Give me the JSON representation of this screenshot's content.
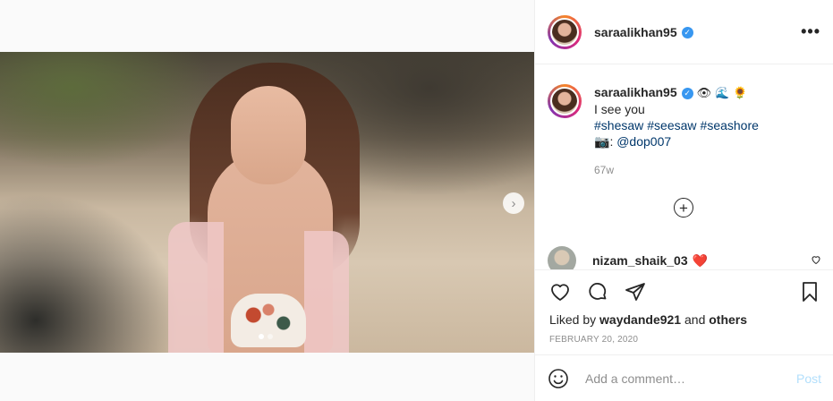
{
  "post": {
    "username": "saraalikhan95",
    "more_label": "•••"
  },
  "caption": {
    "username": "saraalikhan95",
    "emojis": [
      "👁",
      "🌊",
      "🌻"
    ],
    "text": "I see you",
    "hashtags": [
      "#shesaw",
      "#seesaw",
      "#seashore"
    ],
    "credit_emoji": "📷",
    "credit_sep": ":",
    "credit_mention": "@dop007",
    "time_ago": "67w"
  },
  "load_more_label": "+",
  "comments": [
    {
      "username": "nizam_shaik_03",
      "text": "❤️"
    }
  ],
  "likes": {
    "prefix": "Liked by",
    "user": "waydande921",
    "conj": "and",
    "others": "others"
  },
  "date": "FEBRUARY 20, 2020",
  "comment_box": {
    "placeholder": "Add a comment…",
    "post_label": "Post"
  },
  "carousel": {
    "slide_count": 2,
    "active_index": 0,
    "next_label": "›"
  },
  "colors": {
    "accent": "#3897f0",
    "link": "#00376b",
    "heart": "#ed4956",
    "post_disabled": "#b2dffc",
    "muted": "#8e8e8e"
  }
}
